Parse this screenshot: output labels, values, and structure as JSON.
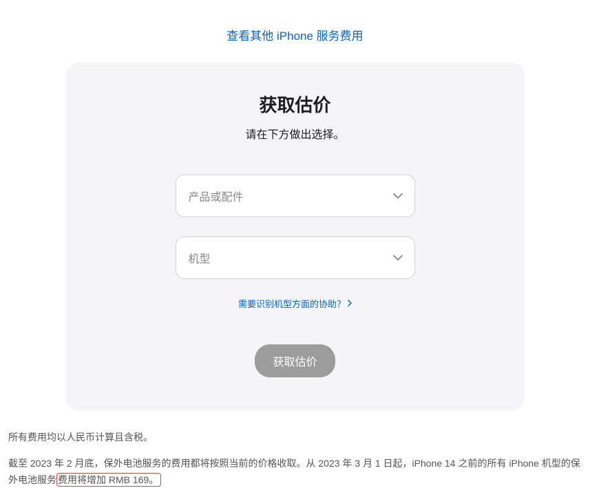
{
  "topLink": {
    "label": "查看其他 iPhone 服务费用"
  },
  "card": {
    "title": "获取估价",
    "subtitle": "请在下方做出选择。",
    "productSelect": {
      "placeholder": "产品或配件"
    },
    "modelSelect": {
      "placeholder": "机型"
    },
    "helpLink": {
      "label": "需要识别机型方面的协助？"
    },
    "submitButton": {
      "label": "获取估价"
    }
  },
  "footer": {
    "line1": "所有费用均以人民币计算且含税。",
    "line2Part1": "截至 2023 年 2 月底，保外电池服务的费用都将按照当前的价格收取。从 2023 年 3 月 1 日起，iPhone 14 之前的所有 iPhone 机型的保外电池服务",
    "line2Highlighted": "费用将增加 RMB 169。"
  }
}
